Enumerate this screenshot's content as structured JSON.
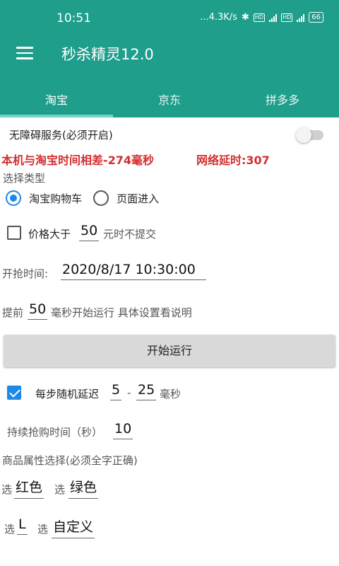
{
  "status": {
    "time": "10:51",
    "net_speed": "...4.3K/s",
    "battery": "66"
  },
  "app": {
    "title": "秒杀精灵12.0"
  },
  "tabs": [
    {
      "label": "淘宝"
    },
    {
      "label": "京东"
    },
    {
      "label": "拼多多"
    }
  ],
  "accessibility": {
    "label": "无障碍服务(必须开启)",
    "enabled": false
  },
  "time_diff": {
    "text": "本机与淘宝时间相差-274毫秒",
    "latency": "网络延时:307"
  },
  "select_type": {
    "label": "选择类型",
    "options": [
      "淘宝购物车",
      "页面进入"
    ],
    "selected": "淘宝购物车"
  },
  "price": {
    "prefix": "价格大于",
    "value": "50",
    "suffix": "元时不提交",
    "checked": false
  },
  "start_time": {
    "label": "开抢时间:",
    "value": "2020/8/17 10:30:00"
  },
  "advance": {
    "prefix": "提前",
    "value": "50",
    "suffix": "毫秒开始运行 具体设置看说明"
  },
  "start_button": {
    "label": "开始运行"
  },
  "delay": {
    "label": "每步随机延迟",
    "min": "5",
    "dash": "-",
    "max": "25",
    "unit": "毫秒",
    "checked": true
  },
  "duration": {
    "label": "持续抢购时间（秒）",
    "value": "10"
  },
  "attributes": {
    "label": "商品属性选择(必须全字正确)",
    "select_word": "选",
    "row1": [
      "红色",
      "绿色"
    ],
    "row2": [
      "L",
      "自定义"
    ]
  }
}
